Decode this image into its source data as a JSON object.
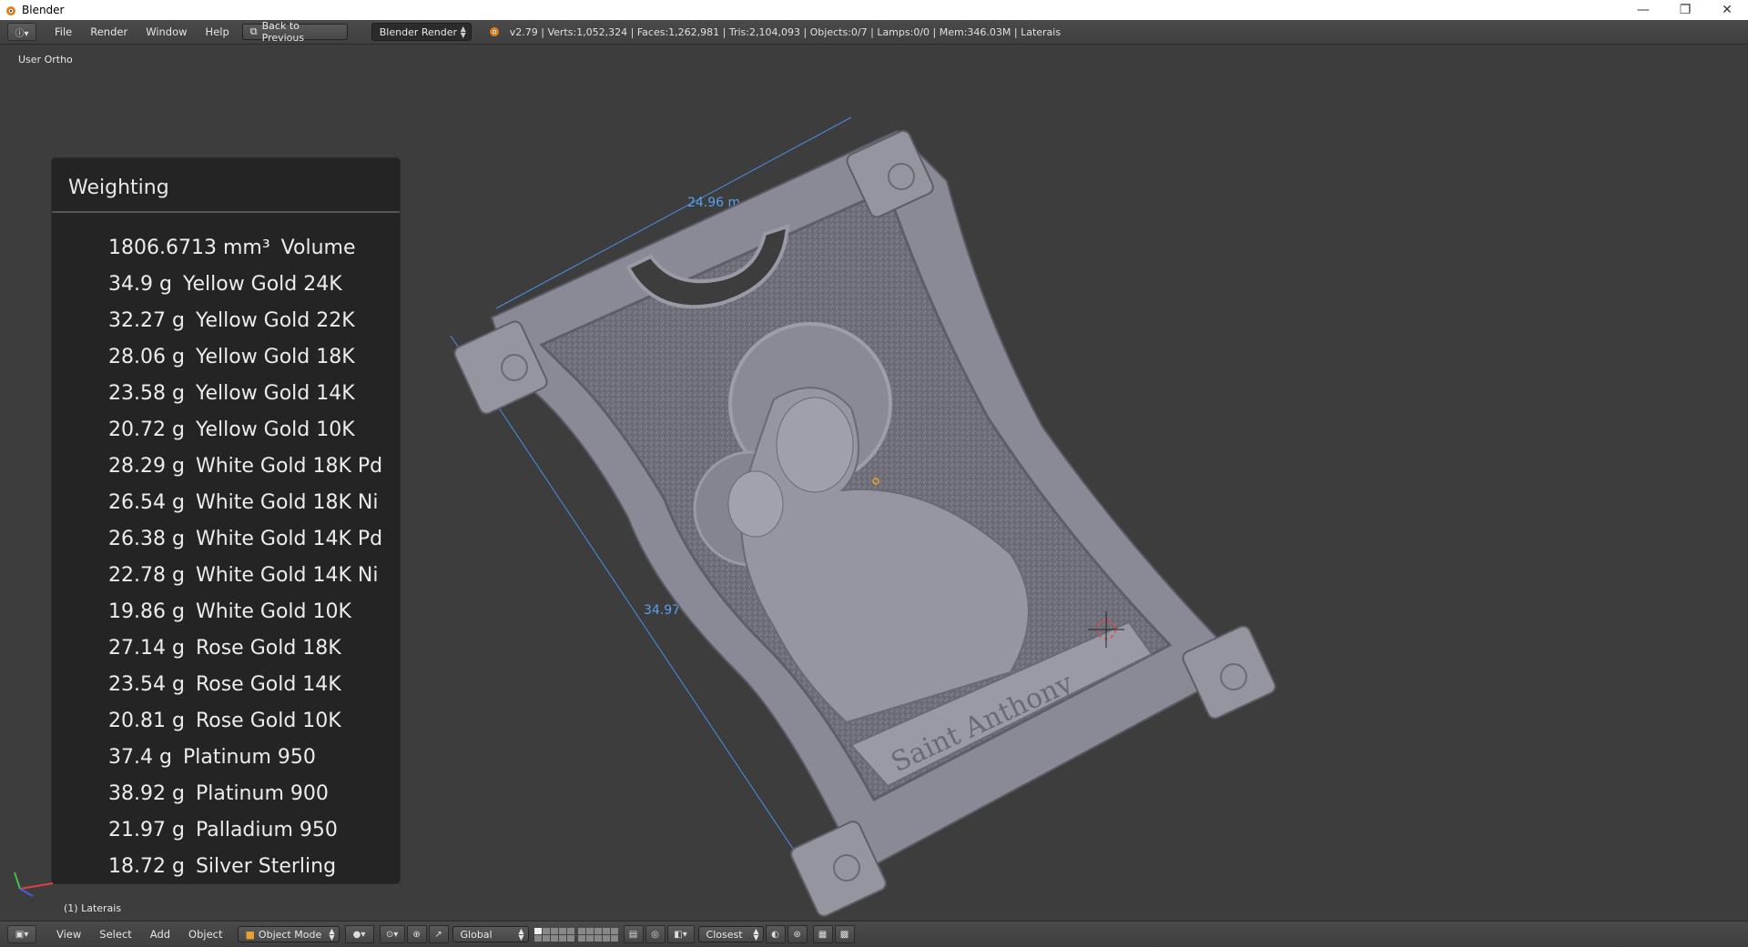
{
  "window": {
    "title": "Blender",
    "minimize": "—",
    "restore": "❐",
    "close": "✕"
  },
  "infobar": {
    "menus": [
      "File",
      "Render",
      "Window",
      "Help"
    ],
    "back_button": "Back to Previous",
    "render_engine": "Blender Render",
    "stats": "v2.79 | Verts:1,052,324 | Faces:1,262,981 | Tris:2,104,093 | Objects:0/7 | Lamps:0/0 | Mem:346.03M | Laterais"
  },
  "viewport": {
    "view_label": "User Ortho",
    "object_label": "(1) Laterais",
    "dimension_width": "24.96 m",
    "dimension_height": "34.97 m",
    "engraving_text": "Saint Anthony"
  },
  "weighting": {
    "title": "Weighting",
    "rows": [
      {
        "amount": "1806.6713 mm³",
        "label": "Volume"
      },
      {
        "amount": "34.9 g",
        "label": "Yellow Gold 24K"
      },
      {
        "amount": "32.27 g",
        "label": "Yellow Gold 22K"
      },
      {
        "amount": "28.06 g",
        "label": "Yellow Gold 18K"
      },
      {
        "amount": "23.58 g",
        "label": "Yellow Gold 14K"
      },
      {
        "amount": "20.72 g",
        "label": "Yellow Gold 10K"
      },
      {
        "amount": "28.29 g",
        "label": "White Gold 18K Pd"
      },
      {
        "amount": "26.54 g",
        "label": "White Gold 18K Ni"
      },
      {
        "amount": "26.38 g",
        "label": "White Gold 14K Pd"
      },
      {
        "amount": "22.78 g",
        "label": "White Gold 14K Ni"
      },
      {
        "amount": "19.86 g",
        "label": "White Gold 10K"
      },
      {
        "amount": "27.14 g",
        "label": "Rose Gold 18K"
      },
      {
        "amount": "23.54 g",
        "label": "Rose Gold 14K"
      },
      {
        "amount": "20.81 g",
        "label": "Rose Gold 10K"
      },
      {
        "amount": "37.4 g",
        "label": "Platinum 950"
      },
      {
        "amount": "38.92 g",
        "label": "Platinum 900"
      },
      {
        "amount": "21.97 g",
        "label": "Palladium 950"
      },
      {
        "amount": "18.72 g",
        "label": "Silver Sterling"
      }
    ]
  },
  "bottombar": {
    "menus": [
      "View",
      "Select",
      "Add",
      "Object"
    ],
    "mode": "Object Mode",
    "orientation": "Global",
    "snap_target": "Closest"
  },
  "colors": {
    "viewport_bg": "#3d3d3d",
    "model": "#8d8d9a",
    "dimension_line": "#4a90e2"
  }
}
